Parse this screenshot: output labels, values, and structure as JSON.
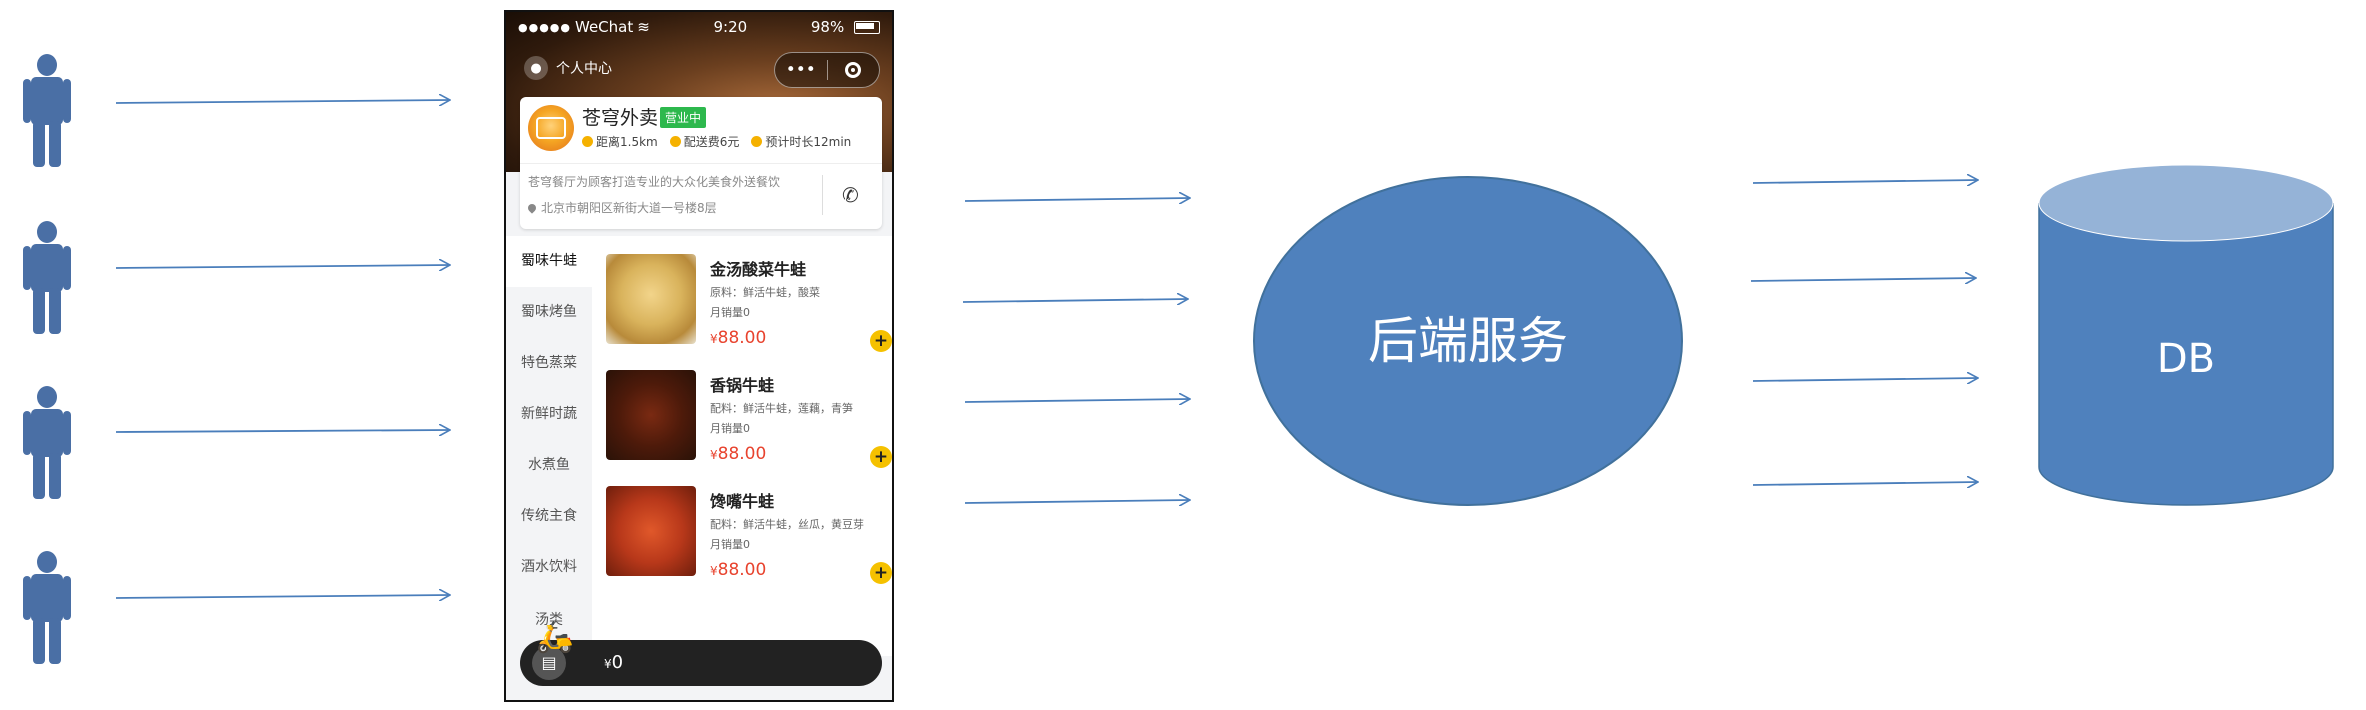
{
  "phone": {
    "status": {
      "carrier": "WeChat",
      "signal": "●●●●●",
      "time": "9:20",
      "battery": "98%"
    },
    "nav": {
      "user_center": "个人中心",
      "menu_dots": "•••"
    },
    "shop": {
      "name": "苍穹外卖",
      "badge": "营业中",
      "distance": "距离1.5km",
      "delivery_fee": "配送费6元",
      "eta": "预计时长12min",
      "description": "苍穹餐厅为顾客打造专业的大众化美食外送餐饮",
      "address": "北京市朝阳区新街大道一号楼8层"
    },
    "categories": [
      "蜀味牛蛙",
      "蜀味烤鱼",
      "特色蒸菜",
      "新鲜时蔬",
      "水煮鱼",
      "传统主食",
      "酒水饮料"
    ],
    "extra_category": "汤类",
    "dishes": [
      {
        "title": "金汤酸菜牛蛙",
        "ingredients": "原料：鲜活牛蛙，酸菜",
        "sales": "月销量0",
        "currency": "¥",
        "price": "88.00",
        "add": "+"
      },
      {
        "title": "香锅牛蛙",
        "ingredients": "配料：鲜活牛蛙，莲藕，青笋",
        "sales": "月销量0",
        "currency": "¥",
        "price": "88.00",
        "add": "+"
      },
      {
        "title": "馋嘴牛蛙",
        "ingredients": "配料：鲜活牛蛙，丝瓜，黄豆芽",
        "sales": "月销量0",
        "currency": "¥",
        "price": "88.00",
        "add": "+"
      }
    ],
    "cart": {
      "currency": "¥",
      "total": "0"
    }
  },
  "backend": {
    "label": "后端服务"
  },
  "database": {
    "label": "DB"
  },
  "colors": {
    "arrow": "#4a7ebb",
    "node": "#4f81bd",
    "db_top": "#95b3d7",
    "user": "#4a6fa5"
  }
}
